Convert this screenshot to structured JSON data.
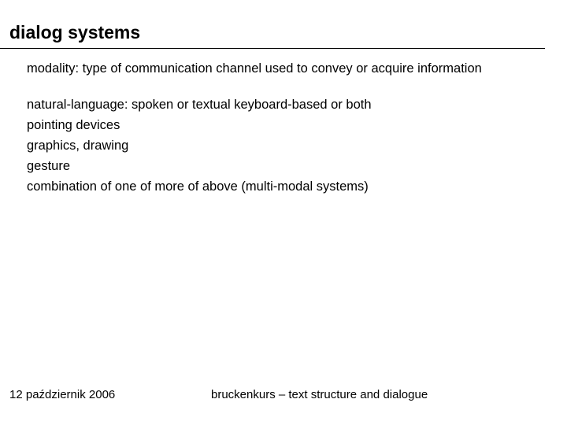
{
  "title": "dialog systems",
  "lead": "modality: type of communication channel used to convey or acquire information",
  "items": [
    "natural-language:  spoken or textual keyboard-based or both",
    "pointing devices",
    "graphics, drawing",
    "gesture",
    "combination of one of more of above (multi-modal systems)"
  ],
  "footer": {
    "date": "12 październik 2006",
    "course": "bruckenkurs – text structure and dialogue"
  }
}
